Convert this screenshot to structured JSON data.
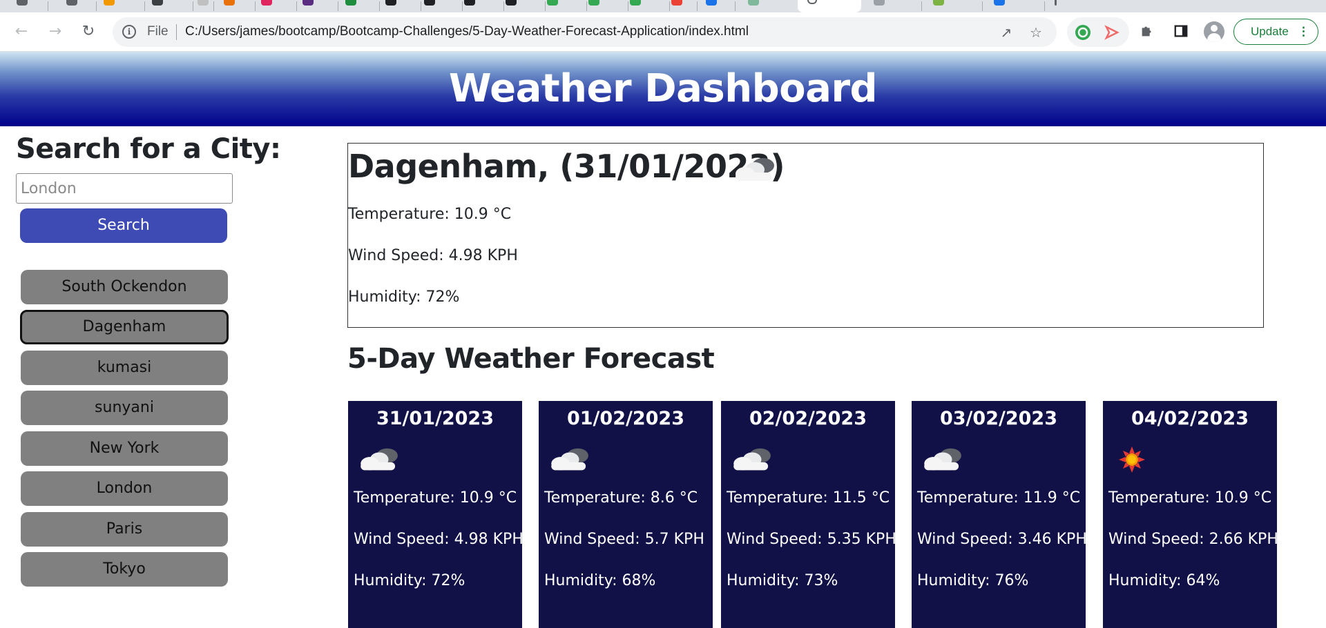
{
  "browser": {
    "url_scheme_label": "File",
    "url": "C:/Users/james/bootcamp/Bootcamp-Challenges/5-Day-Weather-Forecast-Application/index.html",
    "update_label": "Update",
    "update_color": "#188038"
  },
  "header": {
    "title": "Weather Dashboard"
  },
  "sidebar": {
    "search_title": "Search for a City:",
    "search_placeholder": "London",
    "search_button": "Search",
    "search_button_color": "#3f4bb4",
    "history": [
      "South Ockendon",
      "Dagenham",
      "kumasi",
      "sunyani",
      "New York",
      "London",
      "Paris",
      "Tokyo"
    ],
    "active_city": "Dagenham"
  },
  "current": {
    "heading": "Dagenham, (31/01/2023)",
    "icon": "cloud-icon",
    "temperature": "Temperature: 10.9 °C",
    "wind": "Wind Speed: 4.98 KPH",
    "humidity": "Humidity: 72%"
  },
  "forecast": {
    "title": "5-Day Weather Forecast",
    "card_color": "#111148",
    "days": [
      {
        "date": "31/01/2023",
        "icon": "cloud-icon",
        "temperature": "Temperature: 10.9 °C",
        "wind": "Wind Speed: 4.98 KPH",
        "humidity": "Humidity: 72%"
      },
      {
        "date": "01/02/2023",
        "icon": "cloud-icon",
        "temperature": "Temperature: 8.6 °C",
        "wind": "Wind Speed: 5.7 KPH",
        "humidity": "Humidity: 68%"
      },
      {
        "date": "02/02/2023",
        "icon": "cloud-icon",
        "temperature": "Temperature: 11.5 °C",
        "wind": "Wind Speed: 5.35 KPH",
        "humidity": "Humidity: 73%"
      },
      {
        "date": "03/02/2023",
        "icon": "cloud-icon",
        "temperature": "Temperature: 11.9 °C",
        "wind": "Wind Speed: 3.46 KPH",
        "humidity": "Humidity: 76%"
      },
      {
        "date": "04/02/2023",
        "icon": "sun-icon",
        "temperature": "Temperature: 10.9 °C",
        "wind": "Wind Speed: 2.66 KPH",
        "humidity": "Humidity: 64%"
      }
    ]
  }
}
